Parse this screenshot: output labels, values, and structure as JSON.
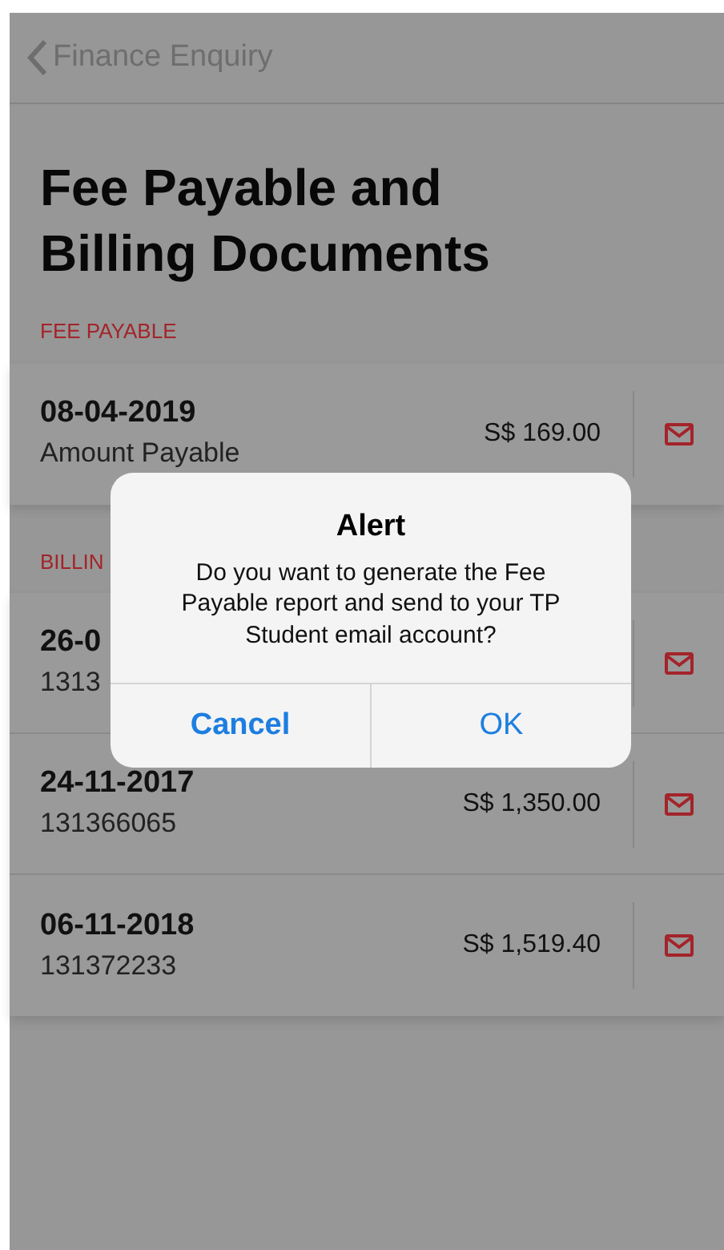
{
  "nav": {
    "back_label": "Finance Enquiry"
  },
  "title": "Fee Payable and Billing Documents",
  "sections": [
    {
      "heading": "FEE PAYABLE",
      "items": [
        {
          "date": "08-04-2019",
          "detail": "Amount Payable",
          "amount": "S$ 169.00"
        }
      ]
    },
    {
      "heading": "BILLIN",
      "items": [
        {
          "date": "26-0",
          "detail": "1313"
        },
        {
          "date": "24-11-2017",
          "detail": "131366065",
          "amount": "S$ 1,350.00"
        },
        {
          "date": "06-11-2018",
          "detail": "131372233",
          "amount": "S$ 1,519.40"
        }
      ]
    }
  ],
  "alert": {
    "title": "Alert",
    "message": "Do you want to generate the Fee Payable report and send to your TP Student email account?",
    "buttons": [
      {
        "label": "Cancel",
        "kind": "cancel"
      },
      {
        "label": "OK",
        "kind": "default"
      }
    ]
  }
}
